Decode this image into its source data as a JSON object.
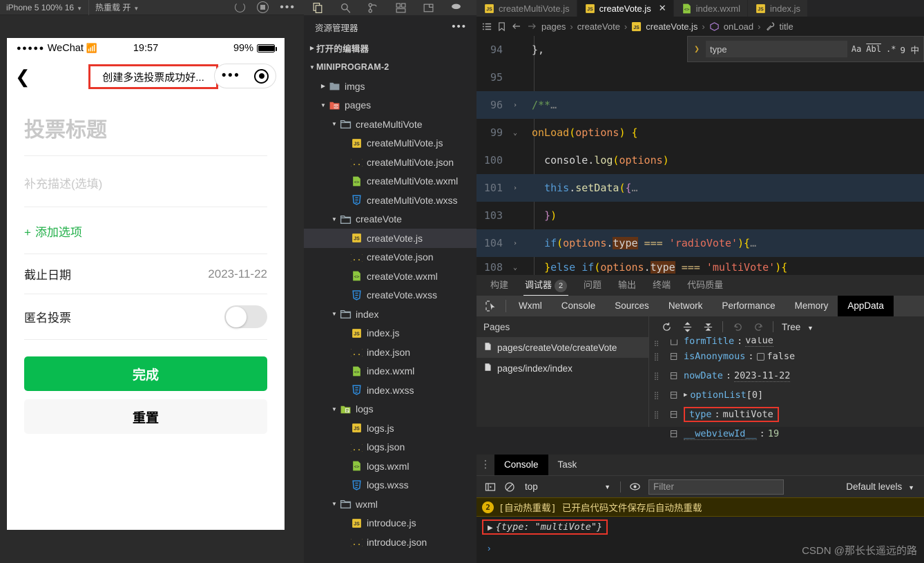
{
  "simulator": {
    "toolbar": {
      "device": "iPhone 5 100% 16",
      "hot_reload": "热重载 开",
      "refresh_icon": "refresh-icon",
      "stop_icon": "stop-icon",
      "more_icon": "more-icon"
    },
    "status_bar": {
      "carrier": "WeChat",
      "signal_dots": "●●●●●",
      "wifi_icon": "wifi-icon",
      "time": "19:57",
      "battery_pct": "99%"
    },
    "nav_bar": {
      "back_icon": "back-chevron-icon",
      "title": "创建多选投票成功好...",
      "capsule_more": "•••",
      "capsule_target": "target-icon"
    },
    "form": {
      "title_placeholder": "投票标题",
      "desc_placeholder": "补充描述(选填)",
      "add_option_plus": "+",
      "add_option_label": "添加选项",
      "deadline_label": "截止日期",
      "deadline_value": "2023-11-22",
      "anonymous_label": "匿名投票",
      "anonymous_on": false,
      "submit_label": "完成",
      "reset_label": "重置"
    }
  },
  "activity_bar": {
    "items": [
      {
        "name": "explorer-icon"
      },
      {
        "name": "search-icon"
      },
      {
        "name": "source-control-icon"
      },
      {
        "name": "extensions-icon"
      },
      {
        "name": "layout-icon"
      },
      {
        "name": "debug-icon"
      }
    ]
  },
  "explorer": {
    "header": "资源管理器",
    "more_icon": "ellipsis-icon",
    "open_editors": "打开的编辑器",
    "project": "MINIPROGRAM-2",
    "tree": [
      {
        "label": "imgs",
        "type": "folder",
        "icon": "folder-plain",
        "depth": 1,
        "expanded": false
      },
      {
        "label": "pages",
        "type": "folder",
        "icon": "folder-pages",
        "depth": 1,
        "expanded": true
      },
      {
        "label": "createMultiVote",
        "type": "folder",
        "icon": "folder-open",
        "depth": 2,
        "expanded": true
      },
      {
        "label": "createMultiVote.js",
        "type": "file",
        "icon": "js",
        "depth": 3
      },
      {
        "label": "createMultiVote.json",
        "type": "file",
        "icon": "json",
        "depth": 3
      },
      {
        "label": "createMultiVote.wxml",
        "type": "file",
        "icon": "wxml",
        "depth": 3
      },
      {
        "label": "createMultiVote.wxss",
        "type": "file",
        "icon": "wxss",
        "depth": 3
      },
      {
        "label": "createVote",
        "type": "folder",
        "icon": "folder-open",
        "depth": 2,
        "expanded": true
      },
      {
        "label": "createVote.js",
        "type": "file",
        "icon": "js",
        "depth": 3,
        "selected": true
      },
      {
        "label": "createVote.json",
        "type": "file",
        "icon": "json",
        "depth": 3
      },
      {
        "label": "createVote.wxml",
        "type": "file",
        "icon": "wxml",
        "depth": 3
      },
      {
        "label": "createVote.wxss",
        "type": "file",
        "icon": "wxss",
        "depth": 3
      },
      {
        "label": "index",
        "type": "folder",
        "icon": "folder-open",
        "depth": 2,
        "expanded": true
      },
      {
        "label": "index.js",
        "type": "file",
        "icon": "js",
        "depth": 3
      },
      {
        "label": "index.json",
        "type": "file",
        "icon": "json",
        "depth": 3
      },
      {
        "label": "index.wxml",
        "type": "file",
        "icon": "wxml",
        "depth": 3
      },
      {
        "label": "index.wxss",
        "type": "file",
        "icon": "wxss",
        "depth": 3
      },
      {
        "label": "logs",
        "type": "folder",
        "icon": "folder-logs",
        "depth": 2,
        "expanded": true
      },
      {
        "label": "logs.js",
        "type": "file",
        "icon": "js",
        "depth": 3
      },
      {
        "label": "logs.json",
        "type": "file",
        "icon": "json",
        "depth": 3
      },
      {
        "label": "logs.wxml",
        "type": "file",
        "icon": "wxml",
        "depth": 3
      },
      {
        "label": "logs.wxss",
        "type": "file",
        "icon": "wxss",
        "depth": 3
      },
      {
        "label": "wxml",
        "type": "folder",
        "icon": "folder-open",
        "depth": 2,
        "expanded": true
      },
      {
        "label": "introduce.js",
        "type": "file",
        "icon": "js",
        "depth": 3
      },
      {
        "label": "introduce.json",
        "type": "file",
        "icon": "json",
        "depth": 3
      }
    ]
  },
  "editor": {
    "tabs": [
      {
        "label": "createMultiVote.js",
        "icon": "js",
        "active": false
      },
      {
        "label": "createVote.js",
        "icon": "js",
        "active": true,
        "close": "✕"
      },
      {
        "label": "index.wxml",
        "icon": "wxml",
        "active": false
      },
      {
        "label": "index.js",
        "icon": "js",
        "active": false
      }
    ],
    "breadcrumb": {
      "list_icon": "list-icon",
      "bookmark_icon": "bookmark-icon",
      "back_icon": "arrow-left-icon",
      "forward_icon": "arrow-right-icon",
      "items": [
        {
          "label": "pages"
        },
        {
          "label": "createVote"
        },
        {
          "label": "createVote.js",
          "icon": "js"
        },
        {
          "label": "onLoad",
          "icon": "symbol-method"
        },
        {
          "label": "title",
          "icon": "symbol-property"
        }
      ]
    },
    "find_widget": {
      "toggle_icon": "chevron-right-icon",
      "query": "type",
      "match_case_icon": "Aa",
      "whole_word_icon": "Abl",
      "regex_icon": ".*",
      "count": "9 中"
    },
    "lines": [
      {
        "num": "94",
        "fold": "",
        "highlight": false
      },
      {
        "num": "95",
        "fold": "",
        "highlight": false
      },
      {
        "num": "96",
        "fold": "›",
        "highlight": true
      },
      {
        "num": "99",
        "fold": "⌄",
        "highlight": false
      },
      {
        "num": "100",
        "fold": "",
        "highlight": false
      },
      {
        "num": "101",
        "fold": "›",
        "highlight": true
      },
      {
        "num": "103",
        "fold": "",
        "highlight": false
      },
      {
        "num": "104",
        "fold": "›",
        "highlight": true
      },
      {
        "num": "108",
        "fold": "⌄",
        "highlight": false
      }
    ]
  },
  "debugger": {
    "panel_tabs": [
      {
        "label": "构建",
        "active": false
      },
      {
        "label": "调试器",
        "active": true,
        "badge": "2"
      },
      {
        "label": "问题",
        "active": false
      },
      {
        "label": "输出",
        "active": false
      },
      {
        "label": "终端",
        "active": false
      },
      {
        "label": "代码质量",
        "active": false
      }
    ],
    "devtools_tabs": [
      {
        "label": "Wxml",
        "active": false
      },
      {
        "label": "Console",
        "active": false
      },
      {
        "label": "Sources",
        "active": false
      },
      {
        "label": "Network",
        "active": false
      },
      {
        "label": "Performance",
        "active": false
      },
      {
        "label": "Memory",
        "active": false
      },
      {
        "label": "AppData",
        "active": true
      }
    ],
    "inspect_icon": "inspect-cursor-icon",
    "pages_header": "Pages",
    "pages": [
      {
        "label": "pages/createVote/createVote",
        "selected": true
      },
      {
        "label": "pages/index/index",
        "selected": false
      }
    ],
    "appdata_toolbar": {
      "refresh_icon": "refresh-icon",
      "expand_icon": "expand-all-icon",
      "collapse_icon": "collapse-all-icon",
      "undo_icon": "undo-icon",
      "redo_icon": "redo-icon",
      "view_mode": "Tree"
    },
    "appdata": [
      {
        "key": "formTitle",
        "colon": ":",
        "value": "value",
        "partial": true
      },
      {
        "key": "isAnonymous",
        "colon": ":",
        "value": "false",
        "checkbox": true
      },
      {
        "key": "nowDate",
        "colon": ":",
        "value": "2023-11-22",
        "underline": true
      },
      {
        "key": "optionList",
        "colon": "",
        "value": "[0]",
        "arrow": true
      },
      {
        "key": "type",
        "colon": ":",
        "value": "multiVote",
        "highlighted": true
      },
      {
        "key": "__webviewId__",
        "colon": ":",
        "value": "19",
        "number": true,
        "underlineKey": true
      }
    ]
  },
  "console": {
    "tabs": [
      {
        "label": "Console",
        "active": true
      },
      {
        "label": "Task",
        "active": false
      }
    ],
    "kebab_icon": "kebab-menu-icon",
    "toolbar": {
      "sidebar_icon": "toggle-sidebar-icon",
      "clear_icon": "clear-console-icon",
      "context": "top",
      "eye_icon": "eye-icon",
      "filter_placeholder": "Filter",
      "levels": "Default levels"
    },
    "warning": {
      "count": "2",
      "text": "[自动热重载] 已开启代码文件保存后自动热重载"
    },
    "output": {
      "arrow": "▶",
      "text": "{type: ",
      "string": "\"multiVote\"",
      "tail": "}"
    },
    "prompt": "›",
    "watermark": "CSDN @那长长遥远的路"
  },
  "colors": {
    "accent_green": "#09BB4F",
    "highlight_red": "#e8362a",
    "link_green": "#23b04a"
  }
}
